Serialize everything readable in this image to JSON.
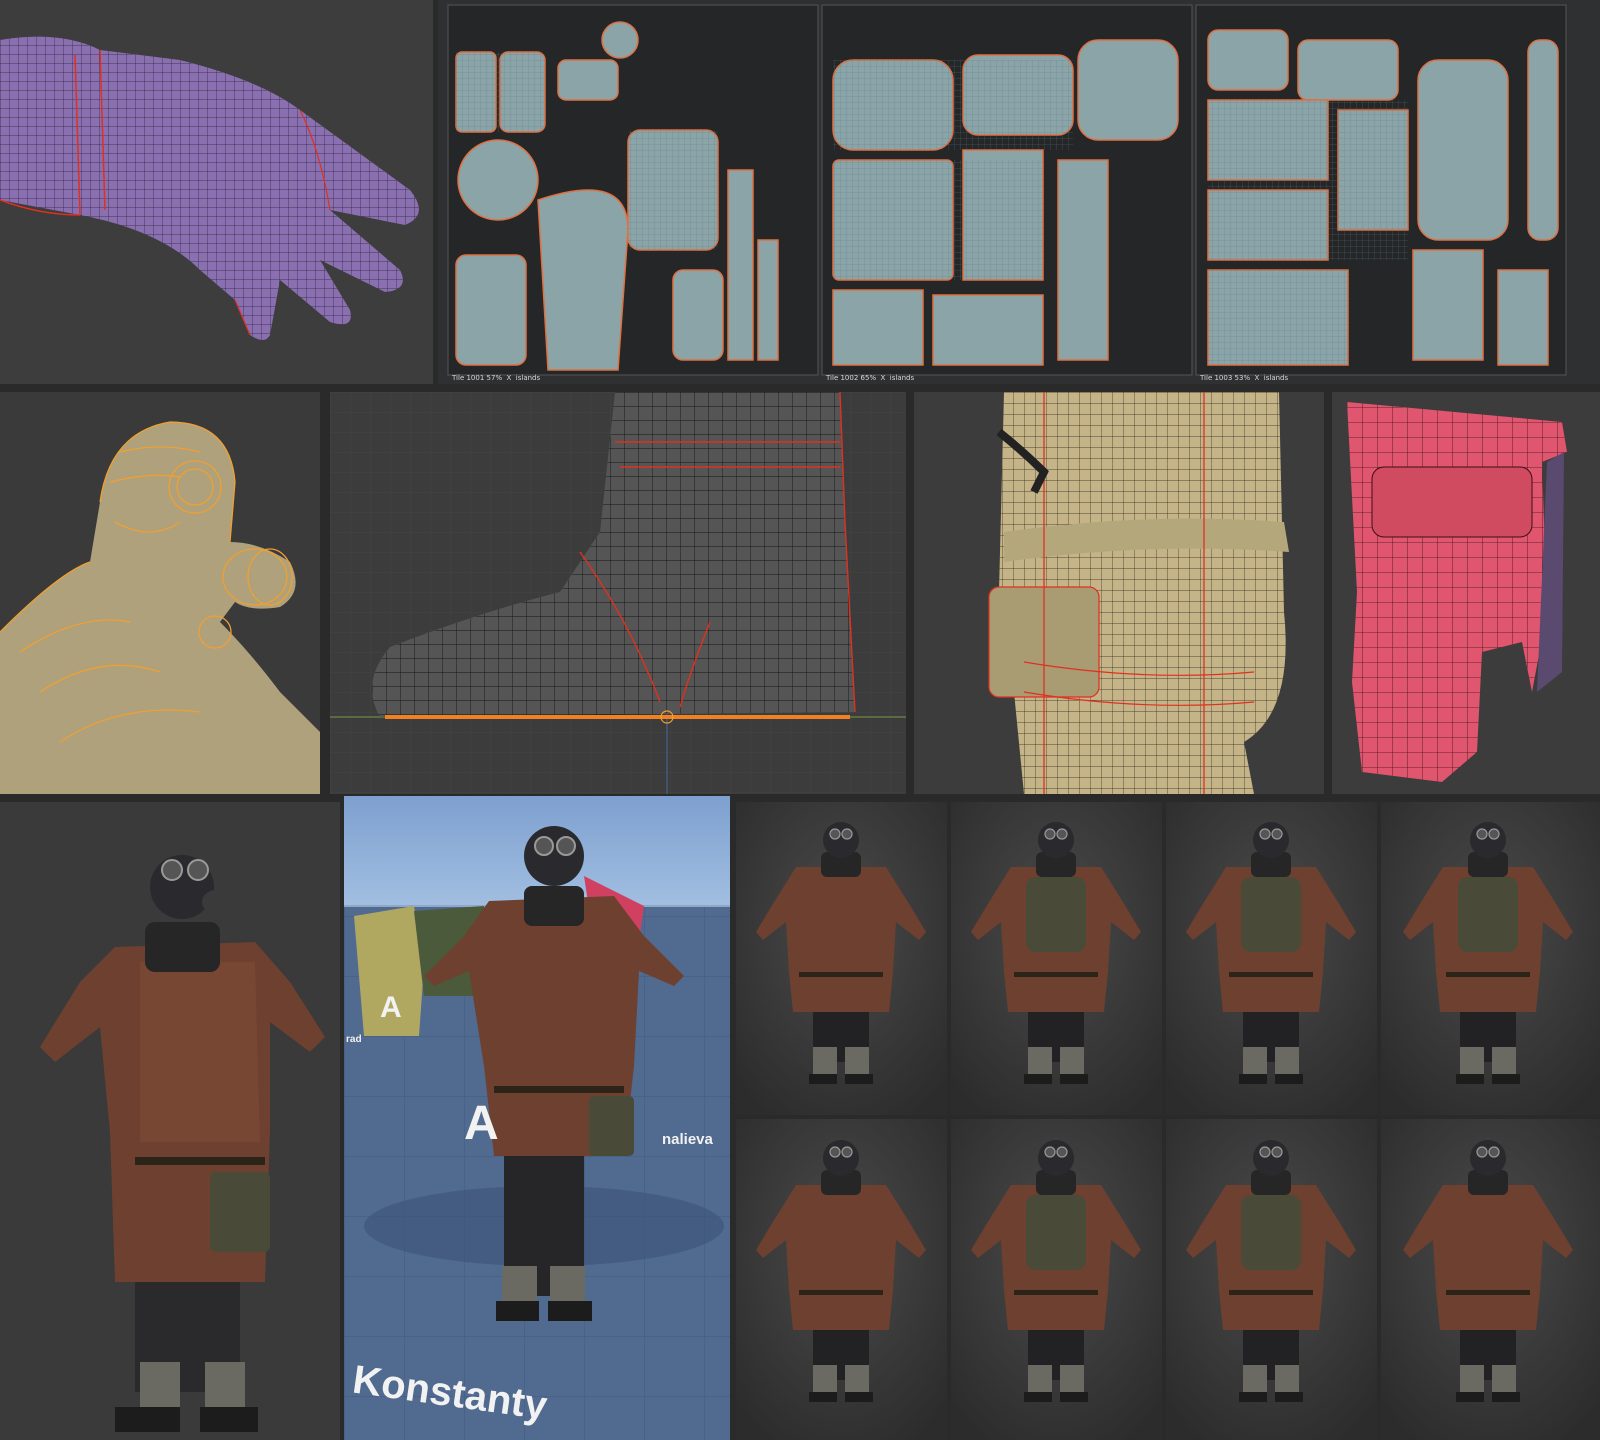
{
  "uv_tiles": [
    {
      "tile": "Tile 1001",
      "percent": "57%",
      "x_label": "X",
      "mode": "islands"
    },
    {
      "tile": "Tile 1002",
      "percent": "65%",
      "x_label": "X",
      "mode": "islands"
    },
    {
      "tile": "Tile 1003",
      "percent": "53%",
      "x_label": "X",
      "mode": "islands"
    }
  ],
  "engine_scene": {
    "big_name": "Konstanty",
    "side_name": "nalieva",
    "small_name": "rad",
    "letter_a1": "A",
    "letter_a2": "A"
  },
  "colors": {
    "blender_bg": "#3c3c3c",
    "glove_mesh": "#8a70b0",
    "mask_wire": "#f0a030",
    "coat_mesh": "#c4b488",
    "pouch_mesh": "#e0566e",
    "seam": "#e03020",
    "uv_island": "#8aa4a8",
    "uv_bg": "#303234",
    "coat_brown": "#6e4030",
    "floor_blue": "#506a90"
  }
}
